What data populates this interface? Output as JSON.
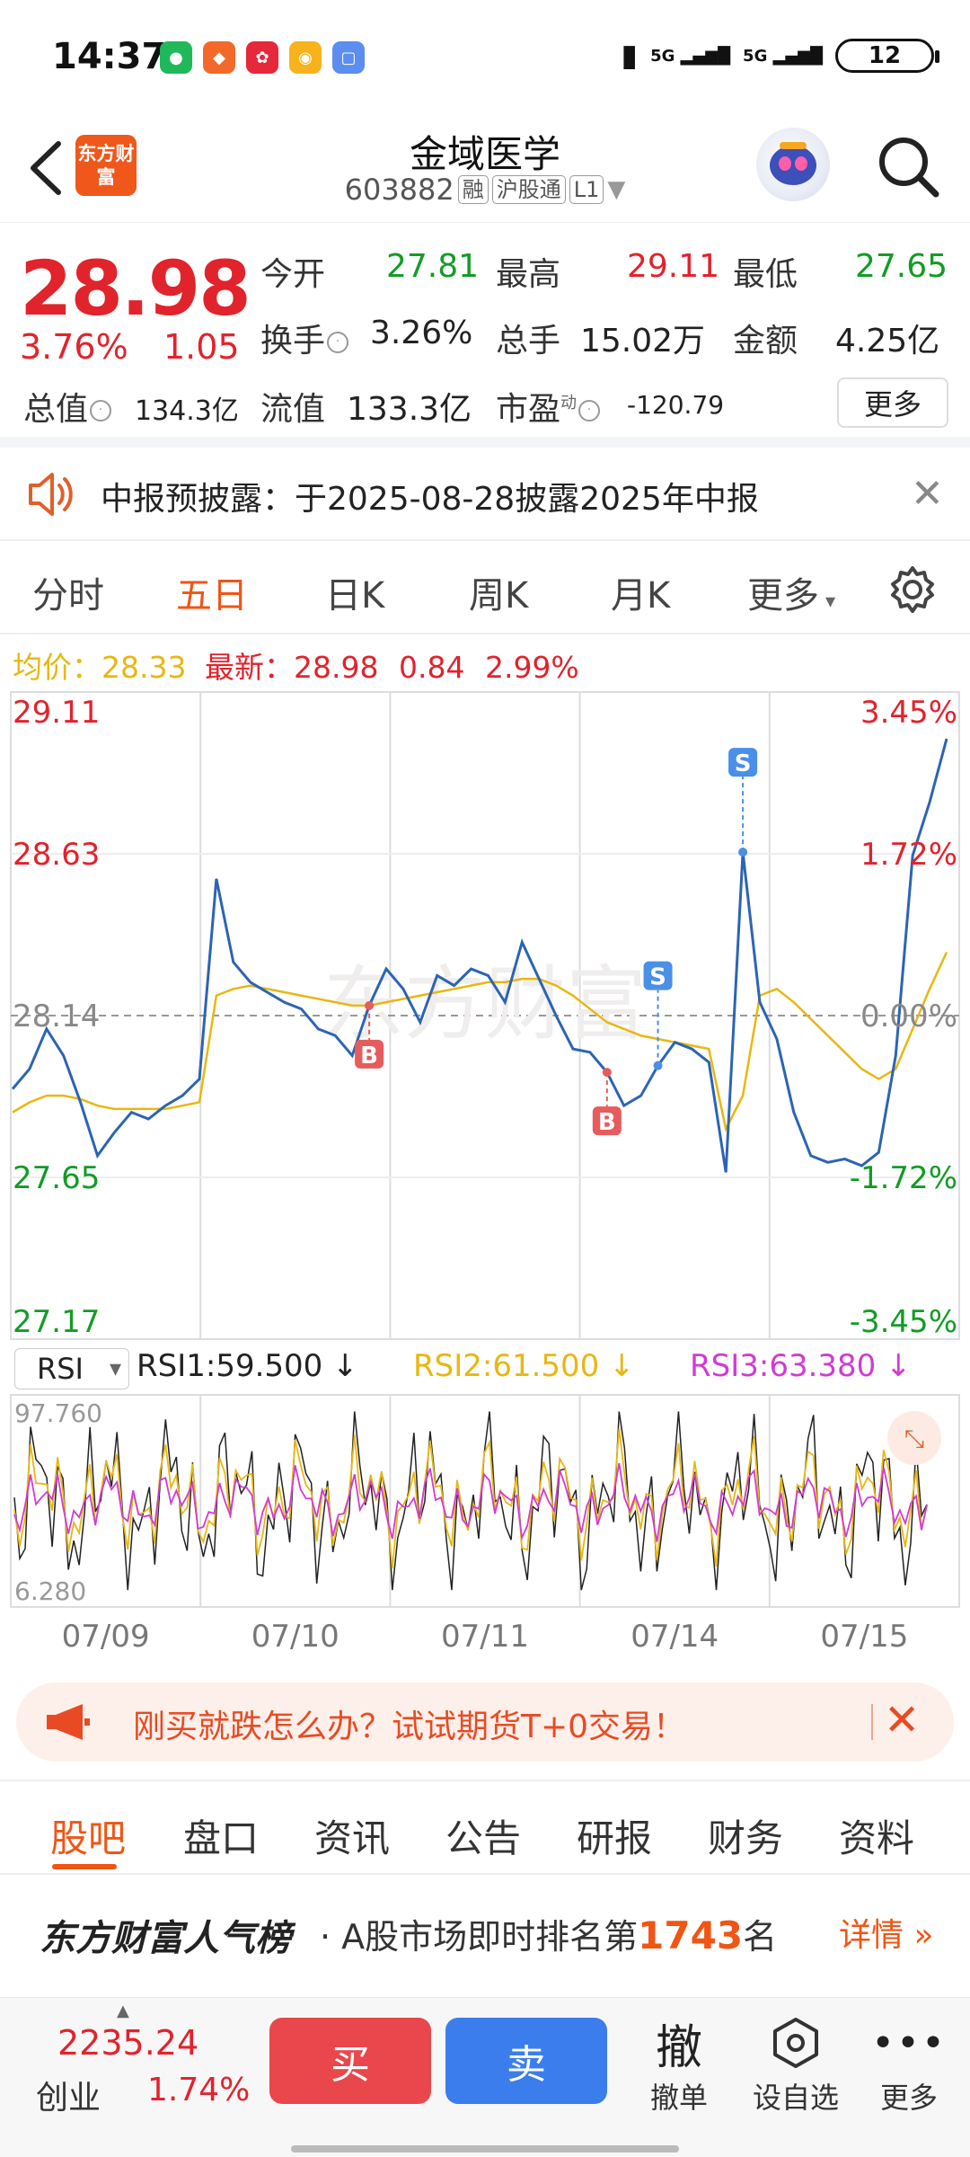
{
  "status_bar": {
    "time": "14:37",
    "battery": "12",
    "signal1": "5G",
    "signal2": "5G"
  },
  "header": {
    "brand_logo": "东方财富",
    "stock_name": "金域医学",
    "stock_code": "603882",
    "tags": [
      "融",
      "沪股通",
      "L1"
    ]
  },
  "quote": {
    "price": "28.98",
    "change_pct": "3.76%",
    "change": "1.05",
    "open_label": "今开",
    "open": "27.81",
    "high_label": "最高",
    "high": "29.11",
    "low_label": "最低",
    "low": "27.65",
    "turnover_label": "换手",
    "turnover": "3.26%",
    "volume_label": "总手",
    "volume": "15.02万",
    "amount_label": "金额",
    "amount": "4.25亿",
    "mktcap_label": "总值",
    "mktcap": "134.3亿",
    "float_label": "流值",
    "float_cap": "133.3亿",
    "pe_label": "市盈",
    "pe_sup": "动",
    "pe": "-120.79",
    "more_label": "更多"
  },
  "notice": {
    "text": "中报预披露：于2025-08-28披露2025年中报"
  },
  "tabs": {
    "items": [
      "分时",
      "五日",
      "日K",
      "周K",
      "月K",
      "更多"
    ],
    "active": "五日"
  },
  "avg_line": {
    "avg_label": "均价：",
    "avg": "28.33",
    "latest_label": "最新：",
    "latest": "28.98",
    "chg": "0.84",
    "pct": "2.99%"
  },
  "chart_data": {
    "type": "line",
    "title": "",
    "x_labels": [
      "07/09",
      "07/10",
      "07/11",
      "07/14",
      "07/15"
    ],
    "price_axis_left": [
      "29.11",
      "28.63",
      "28.14",
      "27.65",
      "27.17"
    ],
    "pct_axis_right": [
      "3.45%",
      "1.72%",
      "0.00%",
      "-1.72%",
      "-3.45%"
    ],
    "ylim": [
      27.17,
      29.11
    ],
    "prev_close": 28.14,
    "watermark": "东方财富",
    "series": [
      {
        "name": "",
        "values": [
          27.92,
          27.98,
          28.1,
          28.02,
          27.88,
          27.72,
          27.79,
          27.85,
          27.83,
          27.87,
          27.9,
          27.95,
          28.55,
          28.3,
          28.24,
          28.21,
          28.18,
          28.16,
          28.1,
          28.08,
          28.02,
          28.17,
          28.28,
          28.22,
          28.12,
          28.26,
          28.23,
          28.28,
          28.26,
          28.18,
          28.36,
          28.25,
          28.14,
          28.04,
          28.03,
          27.97,
          27.87,
          27.9,
          27.99,
          28.06,
          28.04,
          28.0,
          27.67,
          28.63,
          28.18,
          28.07,
          27.85,
          27.72,
          27.7,
          27.71,
          27.69,
          27.73,
          28.02,
          28.62,
          28.78,
          28.97
        ]
      }
    ],
    "avg_series": {
      "values": [
        27.85,
        27.88,
        27.9,
        27.9,
        27.89,
        27.87,
        27.86,
        27.86,
        27.86,
        27.86,
        27.87,
        27.88,
        28.2,
        28.22,
        28.23,
        28.22,
        28.21,
        28.2,
        28.19,
        28.18,
        28.17,
        28.17,
        28.18,
        28.19,
        28.2,
        28.21,
        28.22,
        28.23,
        28.24,
        28.24,
        28.25,
        28.25,
        28.23,
        28.2,
        28.16,
        28.12,
        28.1,
        28.08,
        28.07,
        28.06,
        28.05,
        28.04,
        27.8,
        27.9,
        28.2,
        28.22,
        28.18,
        28.13,
        28.08,
        28.03,
        27.98,
        27.95,
        27.98,
        28.1,
        28.22,
        28.33
      ]
    },
    "markers": [
      {
        "label": "B",
        "index": 21
      },
      {
        "label": "B",
        "index": 35
      },
      {
        "label": "S",
        "index": 38
      },
      {
        "label": "S",
        "index": 43
      }
    ]
  },
  "rsi": {
    "selector": "RSI",
    "rsi1": "RSI1:59.500 ↓",
    "rsi2": "RSI2:61.500 ↓",
    "rsi3": "RSI3:63.380 ↓",
    "max": "97.760",
    "min": "6.280",
    "colors": {
      "rsi1": "#222222",
      "rsi2": "#e8b712",
      "rsi3": "#d13bd3"
    }
  },
  "banner": {
    "text": "刚买就跌怎么办？试试期货T+0交易！"
  },
  "bottom_tabs": {
    "items": [
      "股吧",
      "盘口",
      "资讯",
      "公告",
      "研报",
      "财务",
      "资料"
    ],
    "active": "股吧"
  },
  "popular": {
    "brand": "东方财富人气榜",
    "prefix": "· A股市场即时排名第",
    "rank": "1743",
    "suffix": "名",
    "detail": "详情"
  },
  "dock": {
    "index_value": "2235.24",
    "index_name": "创业",
    "index_pct": "1.74%",
    "buy": "买",
    "sell": "卖",
    "cancel_icon": "撤",
    "cancel": "撤单",
    "watch": "设自选",
    "more": "更多"
  }
}
